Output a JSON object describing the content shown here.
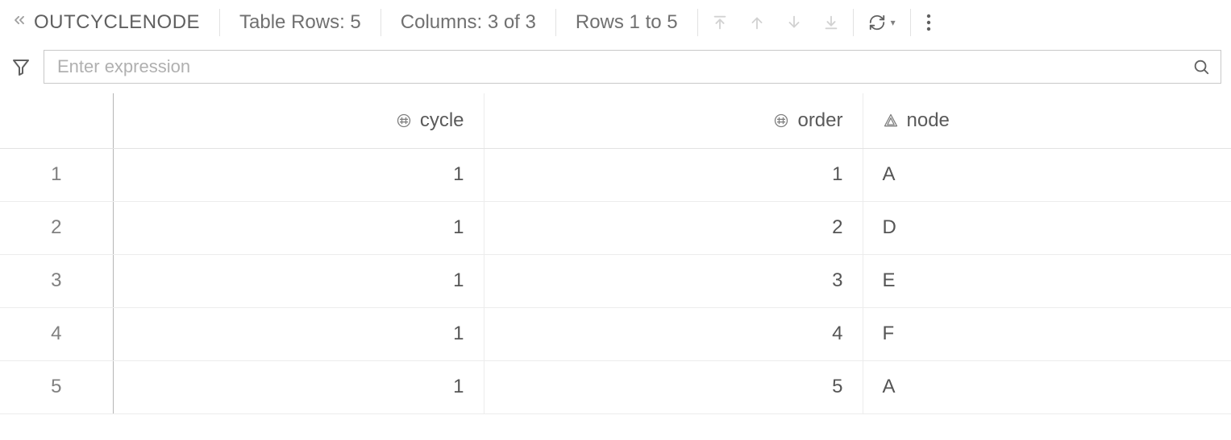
{
  "header": {
    "title": "OUTCYCLENODE",
    "table_rows_label": "Table Rows: 5",
    "columns_label": "Columns: 3 of 3",
    "rows_range_label": "Rows 1 to 5"
  },
  "filter": {
    "placeholder": "Enter expression",
    "value": ""
  },
  "table": {
    "columns": [
      {
        "name": "cycle",
        "type": "numeric",
        "align": "right"
      },
      {
        "name": "order",
        "type": "numeric",
        "align": "right"
      },
      {
        "name": "node",
        "type": "character",
        "align": "left"
      }
    ],
    "rows": [
      {
        "n": "1",
        "cycle": "1",
        "order": "1",
        "node": "A"
      },
      {
        "n": "2",
        "cycle": "1",
        "order": "2",
        "node": "D"
      },
      {
        "n": "3",
        "cycle": "1",
        "order": "3",
        "node": "E"
      },
      {
        "n": "4",
        "cycle": "1",
        "order": "4",
        "node": "F"
      },
      {
        "n": "5",
        "cycle": "1",
        "order": "5",
        "node": "A"
      }
    ]
  }
}
